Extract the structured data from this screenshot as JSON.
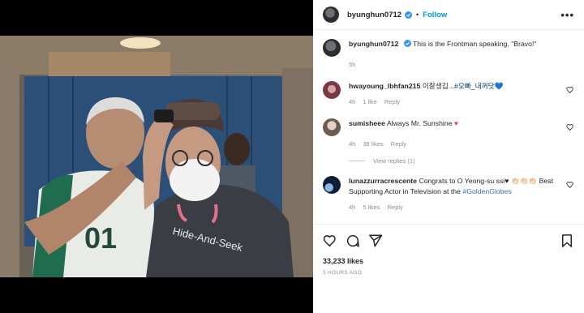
{
  "post": {
    "username": "byunghun0712",
    "follow_label": "Follow",
    "dot": "•",
    "more_label": "•••",
    "caption_text": "This is the Frontman speaking, \"Bravo!\"",
    "caption_time": "5h",
    "likes": "33,233 likes",
    "timestamp": "5 HOURS AGO"
  },
  "comments": [
    {
      "username": "hwayoung_lbhfan215",
      "text_pre": "이잘생김...",
      "tag": "#오빠_내꺼닷",
      "text_post": "💙",
      "time": "4h",
      "likes": "1 like",
      "reply": "Reply"
    },
    {
      "username": "sumisheee",
      "text_pre": "Always Mr. Sunshine ",
      "tag": "",
      "text_post": "♥",
      "time": "4h",
      "likes": "38 likes",
      "reply": "Reply",
      "view_replies": "View replies (1)"
    },
    {
      "username": "lunazzurracrescente",
      "text_pre": "Congrats to O Yeong-su ssi♥ 👏🏻👏🏻👏🏻 Best Supporting Actor in Television at the ",
      "tag": "#GoldenGlobes",
      "text_post": "",
      "time": "4h",
      "likes": "5 likes",
      "reply": "Reply"
    }
  ],
  "photo_shirt_text": "Hide-And-Seek",
  "photo_jersey_number": "01",
  "icons": [
    "heart-icon",
    "comment-icon",
    "share-icon",
    "bookmark-icon"
  ],
  "colors": {
    "accent": "#0095f6",
    "verified": "#3897f0",
    "hashtag": "#00376b",
    "heart": "#ed4956"
  }
}
